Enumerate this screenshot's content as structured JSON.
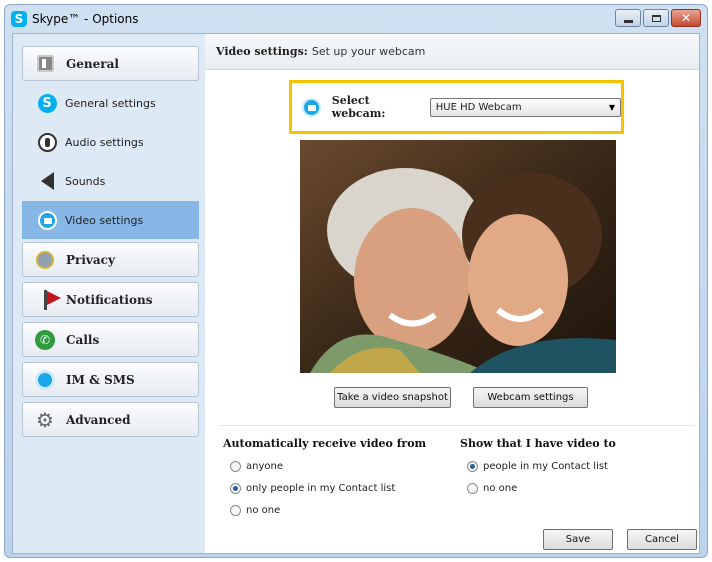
{
  "window": {
    "title": "Skype™ - Options",
    "app_icon": "S"
  },
  "sidebar": {
    "general": "General",
    "items": [
      {
        "label": "General settings",
        "icon": "skype-icon"
      },
      {
        "label": "Audio settings",
        "icon": "audio-icon"
      },
      {
        "label": "Sounds",
        "icon": "sounds-icon"
      },
      {
        "label": "Video settings",
        "icon": "video-icon",
        "active": true
      }
    ],
    "categories": [
      {
        "label": "Privacy",
        "icon": "privacy-icon"
      },
      {
        "label": "Notifications",
        "icon": "flag-icon"
      },
      {
        "label": "Calls",
        "icon": "phone-icon"
      },
      {
        "label": "IM & SMS",
        "icon": "chat-icon"
      },
      {
        "label": "Advanced",
        "icon": "gear-icon"
      }
    ]
  },
  "header": {
    "title_bold": "Video settings:",
    "title_rest": "Set up your webcam"
  },
  "webcam": {
    "label": "Select webcam:",
    "selected": "HUE HD Webcam"
  },
  "buttons": {
    "snapshot": "Take a video snapshot",
    "webcam_settings": "Webcam settings",
    "save": "Save",
    "cancel": "Cancel"
  },
  "receive": {
    "title": "Automatically receive video from",
    "options": [
      "anyone",
      "only people in my Contact list",
      "no one"
    ],
    "selected": 1
  },
  "show": {
    "title": "Show that I have video to",
    "options": [
      "people in my Contact list",
      "no one"
    ],
    "selected": 0
  },
  "colors": {
    "highlight": "#f5c400",
    "active_item": "#86b7e6",
    "skype_blue": "#00aff0"
  }
}
